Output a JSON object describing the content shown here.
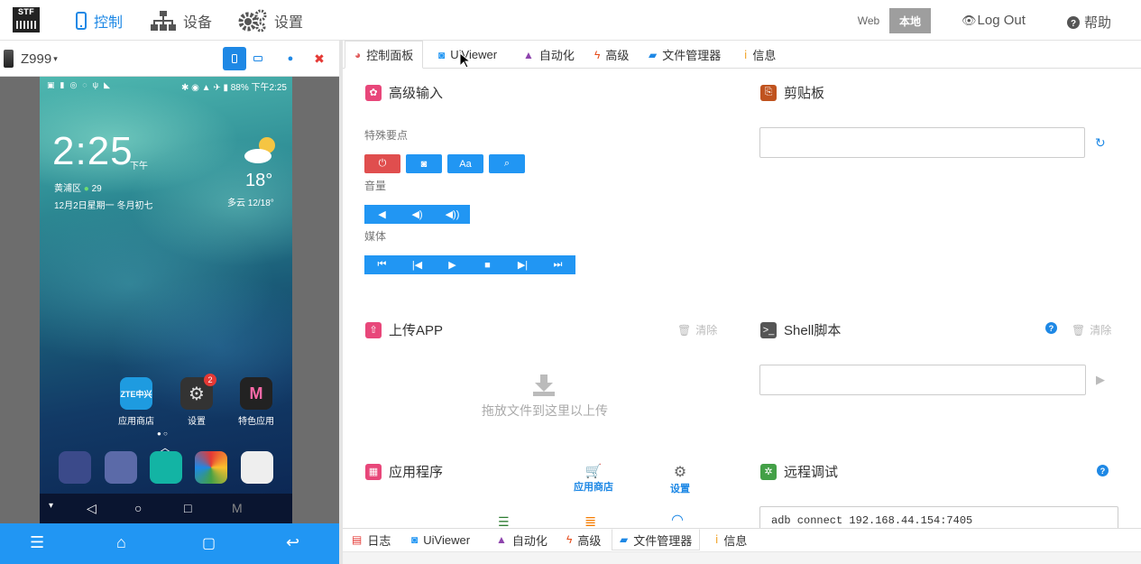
{
  "logo": {
    "text": "STF"
  },
  "nav": {
    "control": "控制",
    "devices": "设备",
    "settings": "设置"
  },
  "env": {
    "web": "Web",
    "local": "本地"
  },
  "user": {
    "logout": "Log Out",
    "help": "帮助"
  },
  "device": {
    "name": "Z999"
  },
  "phone": {
    "battery": "88%",
    "status_time": "下午2:25",
    "clock": "2:25",
    "ampm": "下午",
    "location": "黄浦区",
    "aqi": "29",
    "date": "12月2日星期一 冬月初七",
    "temperature": "18°",
    "weather": "多云 12/18°",
    "apps": [
      {
        "label": "应用商店",
        "icon": "ZTE中兴"
      },
      {
        "label": "设置",
        "badge": "2"
      },
      {
        "label": "特色应用",
        "icon": "M"
      }
    ]
  },
  "tabs": {
    "control_panel": "控制面板",
    "uiviewer": "UiViewer",
    "automation": "自动化",
    "advanced": "高级",
    "file_manager": "文件管理器",
    "info": "信息"
  },
  "advanced_input": {
    "title": "高级输入",
    "special_keys": "特殊要点",
    "volume": "音量",
    "media": "媒体",
    "text_btn": "Aa"
  },
  "clipboard": {
    "title": "剪贴板"
  },
  "upload": {
    "title": "上传APP",
    "clear": "清除",
    "drop_hint": "拖放文件到这里以上传"
  },
  "shell": {
    "title": "Shell脚本",
    "clear": "清除"
  },
  "apps": {
    "title": "应用程序",
    "store": "应用商店",
    "settings": "设置"
  },
  "remote_debug": {
    "title": "远程调试",
    "command": "adb connect 192.168.44.154:7405"
  },
  "bottom_tabs": {
    "logs": "日志",
    "uiviewer": "UiViewer",
    "automation": "自动化",
    "advanced": "高级",
    "file_manager": "文件管理器",
    "info": "信息"
  }
}
